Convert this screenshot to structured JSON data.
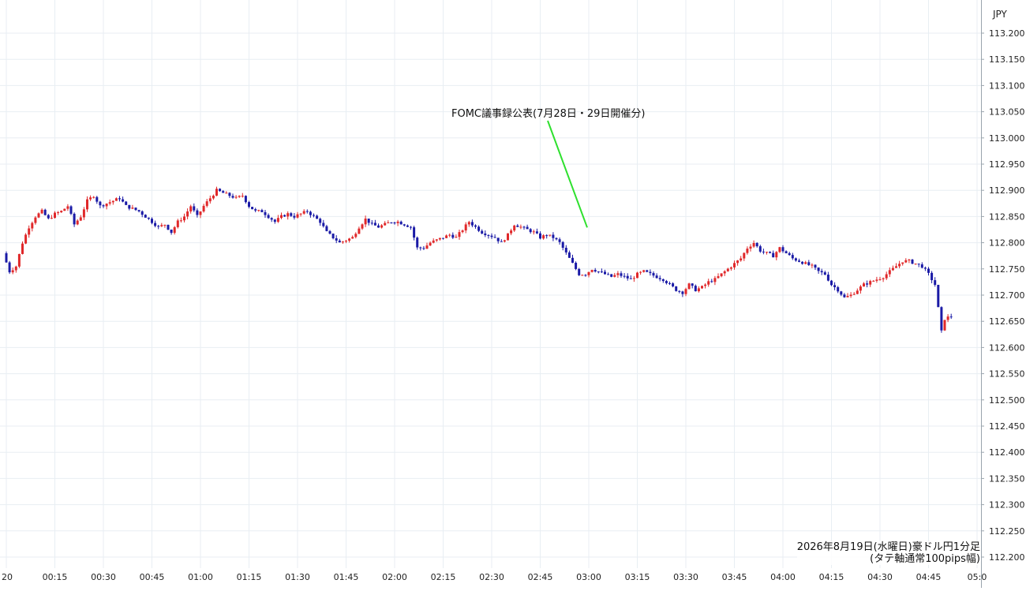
{
  "currency_label": "JPY",
  "caption": {
    "line1": "2026年8月19日(水曜日)豪ドル円1分足",
    "line2": "(タテ軸通常100pips幅)"
  },
  "annotation": {
    "text": "FOMC議事録公表(7月28日・29日開催分)",
    "time": "03:00",
    "price": 112.82
  },
  "colors": {
    "up": "#e0282a",
    "down": "#1a1aa6",
    "grid": "#e8eef3",
    "arrow": "#2ee02e"
  },
  "chart_data": {
    "type": "candlestick",
    "ylim": [
      112.2,
      113.2
    ],
    "yticks": [
      "113.200",
      "113.150",
      "113.100",
      "113.050",
      "113.000",
      "112.950",
      "112.900",
      "112.850",
      "112.800",
      "112.750",
      "112.700",
      "112.650",
      "112.600",
      "112.550",
      "112.500",
      "112.450",
      "112.400",
      "112.350",
      "112.300",
      "112.250",
      "112.200"
    ],
    "xticks": [
      "20",
      "00:15",
      "00:30",
      "00:45",
      "01:00",
      "01:15",
      "01:30",
      "01:45",
      "02:00",
      "02:15",
      "02:30",
      "02:45",
      "03:00",
      "03:15",
      "03:30",
      "03:45",
      "04:00",
      "04:15",
      "04:30",
      "04:45",
      "05:0"
    ],
    "close_path": [
      [
        -1,
        112.78
      ],
      [
        1,
        112.745
      ],
      [
        3,
        112.755
      ],
      [
        5,
        112.8
      ],
      [
        7,
        112.83
      ],
      [
        9,
        112.85
      ],
      [
        11,
        112.86
      ],
      [
        13,
        112.845
      ],
      [
        15,
        112.855
      ],
      [
        17,
        112.86
      ],
      [
        19,
        112.87
      ],
      [
        21,
        112.835
      ],
      [
        23,
        112.85
      ],
      [
        25,
        112.88
      ],
      [
        27,
        112.89
      ],
      [
        29,
        112.87
      ],
      [
        31,
        112.875
      ],
      [
        33,
        112.88
      ],
      [
        35,
        112.885
      ],
      [
        37,
        112.87
      ],
      [
        39,
        112.865
      ],
      [
        41,
        112.86
      ],
      [
        43,
        112.85
      ],
      [
        45,
        112.84
      ],
      [
        47,
        112.83
      ],
      [
        49,
        112.835
      ],
      [
        51,
        112.82
      ],
      [
        53,
        112.84
      ],
      [
        55,
        112.85
      ],
      [
        57,
        112.87
      ],
      [
        59,
        112.85
      ],
      [
        61,
        112.87
      ],
      [
        63,
        112.885
      ],
      [
        65,
        112.9
      ],
      [
        67,
        112.895
      ],
      [
        69,
        112.89
      ],
      [
        71,
        112.885
      ],
      [
        73,
        112.89
      ],
      [
        75,
        112.87
      ],
      [
        77,
        112.86
      ],
      [
        79,
        112.86
      ],
      [
        81,
        112.85
      ],
      [
        83,
        112.84
      ],
      [
        85,
        112.85
      ],
      [
        87,
        112.855
      ],
      [
        89,
        112.85
      ],
      [
        91,
        112.855
      ],
      [
        93,
        112.86
      ],
      [
        95,
        112.85
      ],
      [
        97,
        112.84
      ],
      [
        99,
        112.82
      ],
      [
        101,
        112.81
      ],
      [
        103,
        112.8
      ],
      [
        105,
        112.805
      ],
      [
        107,
        112.81
      ],
      [
        109,
        112.83
      ],
      [
        111,
        112.845
      ],
      [
        113,
        112.835
      ],
      [
        115,
        112.83
      ],
      [
        117,
        112.835
      ],
      [
        119,
        112.84
      ],
      [
        121,
        112.84
      ],
      [
        123,
        112.835
      ],
      [
        125,
        112.83
      ],
      [
        127,
        112.79
      ],
      [
        129,
        112.79
      ],
      [
        131,
        112.8
      ],
      [
        133,
        112.805
      ],
      [
        135,
        112.81
      ],
      [
        137,
        112.815
      ],
      [
        139,
        112.81
      ],
      [
        141,
        112.825
      ],
      [
        143,
        112.84
      ],
      [
        145,
        112.83
      ],
      [
        147,
        112.82
      ],
      [
        149,
        112.815
      ],
      [
        151,
        112.81
      ],
      [
        153,
        112.8
      ],
      [
        155,
        112.815
      ],
      [
        157,
        112.835
      ],
      [
        159,
        112.83
      ],
      [
        161,
        112.825
      ],
      [
        163,
        112.82
      ],
      [
        165,
        112.81
      ],
      [
        167,
        112.815
      ],
      [
        169,
        112.81
      ],
      [
        171,
        112.8
      ],
      [
        173,
        112.78
      ],
      [
        175,
        112.76
      ],
      [
        177,
        112.74
      ],
      [
        179,
        112.74
      ],
      [
        181,
        112.75
      ],
      [
        183,
        112.745
      ],
      [
        185,
        112.74
      ],
      [
        187,
        112.735
      ],
      [
        189,
        112.74
      ],
      [
        191,
        112.735
      ],
      [
        193,
        112.73
      ],
      [
        195,
        112.74
      ],
      [
        197,
        112.745
      ],
      [
        199,
        112.74
      ],
      [
        201,
        112.735
      ],
      [
        203,
        112.73
      ],
      [
        205,
        112.72
      ],
      [
        207,
        112.71
      ],
      [
        209,
        112.705
      ],
      [
        211,
        112.72
      ],
      [
        213,
        112.71
      ],
      [
        215,
        112.715
      ],
      [
        217,
        112.725
      ],
      [
        219,
        112.73
      ],
      [
        221,
        112.74
      ],
      [
        223,
        112.75
      ],
      [
        225,
        112.76
      ],
      [
        227,
        112.77
      ],
      [
        229,
        112.79
      ],
      [
        231,
        112.8
      ],
      [
        233,
        112.785
      ],
      [
        235,
        112.78
      ],
      [
        237,
        112.775
      ],
      [
        239,
        112.79
      ],
      [
        241,
        112.78
      ],
      [
        243,
        112.77
      ],
      [
        245,
        112.765
      ],
      [
        247,
        112.76
      ],
      [
        249,
        112.755
      ],
      [
        251,
        112.745
      ],
      [
        253,
        112.74
      ],
      [
        255,
        112.72
      ],
      [
        257,
        112.71
      ],
      [
        259,
        112.695
      ],
      [
        261,
        112.7
      ],
      [
        263,
        112.71
      ],
      [
        265,
        112.72
      ],
      [
        267,
        112.725
      ],
      [
        269,
        112.73
      ],
      [
        271,
        112.735
      ],
      [
        273,
        112.745
      ],
      [
        275,
        112.755
      ],
      [
        277,
        112.765
      ],
      [
        279,
        112.765
      ],
      [
        281,
        112.76
      ],
      [
        283,
        112.755
      ],
      [
        285,
        112.74
      ],
      [
        287,
        112.72
      ],
      [
        289,
        112.63
      ],
      [
        290,
        112.655
      ],
      [
        292,
        112.66
      ]
    ]
  }
}
